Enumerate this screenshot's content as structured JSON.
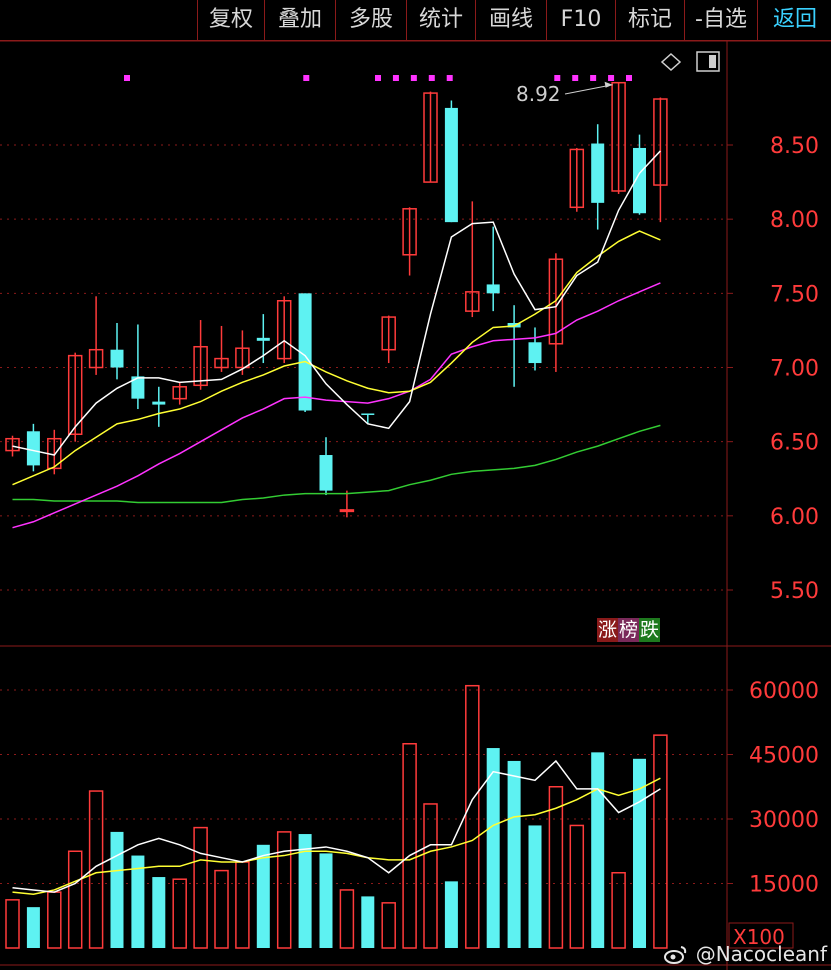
{
  "toolbar": {
    "tabs": [
      "复权",
      "叠加",
      "多股",
      "统计",
      "画线",
      "F10",
      "标记",
      "-自选",
      "返回"
    ]
  },
  "icons": {
    "draw_icon": "diamond-icon",
    "panel_icon": "panel-toggle-icon"
  },
  "colors": {
    "up": "#ff3b3b",
    "down": "#5ef2f2",
    "grid": "#8b1a1a",
    "ma5": "#ffffff",
    "ma10": "#ffff33",
    "ma20": "#ff33ff",
    "ma60": "#33cc33",
    "marker": "#ff33ff",
    "price_axis": "#ff3b3b"
  },
  "price_panel": {
    "y_ticks": [
      "8.50",
      "8.00",
      "7.50",
      "7.00",
      "6.50",
      "6.00",
      "5.50"
    ],
    "high_annotation": "8.92"
  },
  "volume_panel": {
    "y_ticks": [
      "60000",
      "45000",
      "30000",
      "15000"
    ],
    "unit_label": "X100"
  },
  "rank_button": {
    "part1": "涨",
    "part2": "榜",
    "part3": "跌"
  },
  "watermark": "@Nacocleanf",
  "chart_data": {
    "type": "candlestick",
    "candles": [
      {
        "o": 6.44,
        "c": 6.52,
        "h": 6.54,
        "l": 6.4
      },
      {
        "o": 6.57,
        "c": 6.34,
        "h": 6.62,
        "l": 6.3
      },
      {
        "o": 6.32,
        "c": 6.52,
        "h": 6.58,
        "l": 6.28
      },
      {
        "o": 6.55,
        "c": 7.08,
        "h": 7.1,
        "l": 6.5
      },
      {
        "o": 7.0,
        "c": 7.12,
        "h": 7.48,
        "l": 6.95
      },
      {
        "o": 7.12,
        "c": 7.0,
        "h": 7.3,
        "l": 6.92
      },
      {
        "o": 6.94,
        "c": 6.79,
        "h": 7.29,
        "l": 6.72
      },
      {
        "o": 6.77,
        "c": 6.75,
        "h": 6.87,
        "l": 6.6
      },
      {
        "o": 6.79,
        "c": 6.87,
        "h": 6.9,
        "l": 6.75
      },
      {
        "o": 6.88,
        "c": 7.14,
        "h": 7.32,
        "l": 6.85
      },
      {
        "o": 7.0,
        "c": 7.06,
        "h": 7.28,
        "l": 6.97
      },
      {
        "o": 7.0,
        "c": 7.13,
        "h": 7.25,
        "l": 6.95
      },
      {
        "o": 7.2,
        "c": 7.18,
        "h": 7.36,
        "l": 7.03
      },
      {
        "o": 7.06,
        "c": 7.45,
        "h": 7.48,
        "l": 7.03
      },
      {
        "o": 7.5,
        "c": 6.71,
        "h": 7.5,
        "l": 6.7
      },
      {
        "o": 6.41,
        "c": 6.17,
        "h": 6.53,
        "l": 6.14
      },
      {
        "o": 6.04,
        "c": 6.04,
        "h": 6.17,
        "l": 5.99
      },
      {
        "o": 6.69,
        "c": 6.68,
        "h": 6.69,
        "l": 6.62
      },
      {
        "o": 7.12,
        "c": 7.34,
        "h": 7.35,
        "l": 7.03
      },
      {
        "o": 7.76,
        "c": 8.07,
        "h": 8.08,
        "l": 7.62
      },
      {
        "o": 8.25,
        "c": 8.85,
        "h": 8.86,
        "l": 8.25
      },
      {
        "o": 8.75,
        "c": 7.98,
        "h": 8.8,
        "l": 7.98
      },
      {
        "o": 7.38,
        "c": 7.51,
        "h": 8.12,
        "l": 7.34
      },
      {
        "o": 7.56,
        "c": 7.5,
        "h": 7.95,
        "l": 7.38
      },
      {
        "o": 7.3,
        "c": 7.27,
        "h": 7.42,
        "l": 6.87
      },
      {
        "o": 7.17,
        "c": 7.03,
        "h": 7.27,
        "l": 6.98
      },
      {
        "o": 7.16,
        "c": 7.73,
        "h": 7.77,
        "l": 6.97
      },
      {
        "o": 8.08,
        "c": 8.47,
        "h": 8.48,
        "l": 8.05
      },
      {
        "o": 8.51,
        "c": 8.11,
        "h": 8.64,
        "l": 7.93
      },
      {
        "o": 8.19,
        "c": 8.92,
        "h": 8.92,
        "l": 8.17
      },
      {
        "o": 8.48,
        "c": 8.04,
        "h": 8.57,
        "l": 8.03
      },
      {
        "o": 8.23,
        "c": 8.81,
        "h": 8.82,
        "l": 7.98
      }
    ],
    "ma5": [
      6.47,
      6.44,
      6.41,
      6.6,
      6.76,
      6.86,
      6.93,
      6.93,
      6.9,
      6.91,
      6.92,
      6.99,
      7.08,
      7.18,
      7.08,
      6.89,
      6.75,
      6.62,
      6.59,
      6.77,
      7.36,
      7.88,
      7.97,
      7.98,
      7.63,
      7.39,
      7.41,
      7.62,
      7.71,
      8.06,
      8.31,
      8.46
    ],
    "ma10": [
      6.21,
      6.27,
      6.33,
      6.44,
      6.53,
      6.62,
      6.65,
      6.69,
      6.72,
      6.77,
      6.84,
      6.9,
      6.95,
      7.01,
      7.04,
      6.97,
      6.91,
      6.86,
      6.83,
      6.84,
      6.9,
      7.03,
      7.17,
      7.27,
      7.28,
      7.36,
      7.45,
      7.64,
      7.75,
      7.85,
      7.92,
      7.86
    ],
    "ma20": [
      5.92,
      5.96,
      6.02,
      6.08,
      6.14,
      6.2,
      6.27,
      6.35,
      6.42,
      6.5,
      6.58,
      6.66,
      6.72,
      6.79,
      6.8,
      6.78,
      6.77,
      6.76,
      6.79,
      6.84,
      6.92,
      7.09,
      7.14,
      7.18,
      7.19,
      7.2,
      7.23,
      7.32,
      7.38,
      7.45,
      7.51,
      7.57
    ],
    "ma60": [
      6.11,
      6.11,
      6.1,
      6.1,
      6.1,
      6.1,
      6.09,
      6.09,
      6.09,
      6.09,
      6.09,
      6.11,
      6.12,
      6.14,
      6.15,
      6.15,
      6.15,
      6.16,
      6.17,
      6.21,
      6.24,
      6.28,
      6.3,
      6.31,
      6.32,
      6.34,
      6.38,
      6.43,
      6.47,
      6.52,
      6.57,
      6.61
    ],
    "volume": [
      11200,
      9500,
      13000,
      22500,
      36500,
      27000,
      21500,
      16500,
      16000,
      28000,
      18000,
      20000,
      24000,
      27000,
      26500,
      22000,
      13500,
      12000,
      10500,
      47500,
      33500,
      15500,
      61000,
      46500,
      43500,
      28500,
      37500,
      28500,
      45500,
      17500,
      44000,
      49500
    ],
    "vol_ma5": [
      14000,
      13500,
      13000,
      15000,
      19000,
      21500,
      24000,
      25500,
      24000,
      22000,
      21000,
      20000,
      21500,
      22500,
      23000,
      23500,
      22500,
      21000,
      17500,
      21500,
      24000,
      24000,
      34500,
      41000,
      40000,
      39000,
      43500,
      37000,
      37000,
      31500,
      34000,
      37000
    ],
    "vol_ma10": [
      13000,
      12500,
      13500,
      15500,
      17500,
      18000,
      18500,
      19000,
      19000,
      20500,
      20000,
      20000,
      21000,
      21500,
      22500,
      22500,
      22000,
      21000,
      20500,
      20500,
      22500,
      23500,
      25000,
      28500,
      30500,
      31000,
      32500,
      34500,
      37000,
      35500,
      37000,
      39500
    ],
    "price_ylim": [
      5.35,
      9.35
    ],
    "volume_ylim": [
      0,
      72000
    ],
    "markers_at_index": [
      7,
      17,
      21,
      22,
      23,
      24,
      25,
      31,
      32,
      33,
      34,
      35
    ],
    "grid": true
  }
}
